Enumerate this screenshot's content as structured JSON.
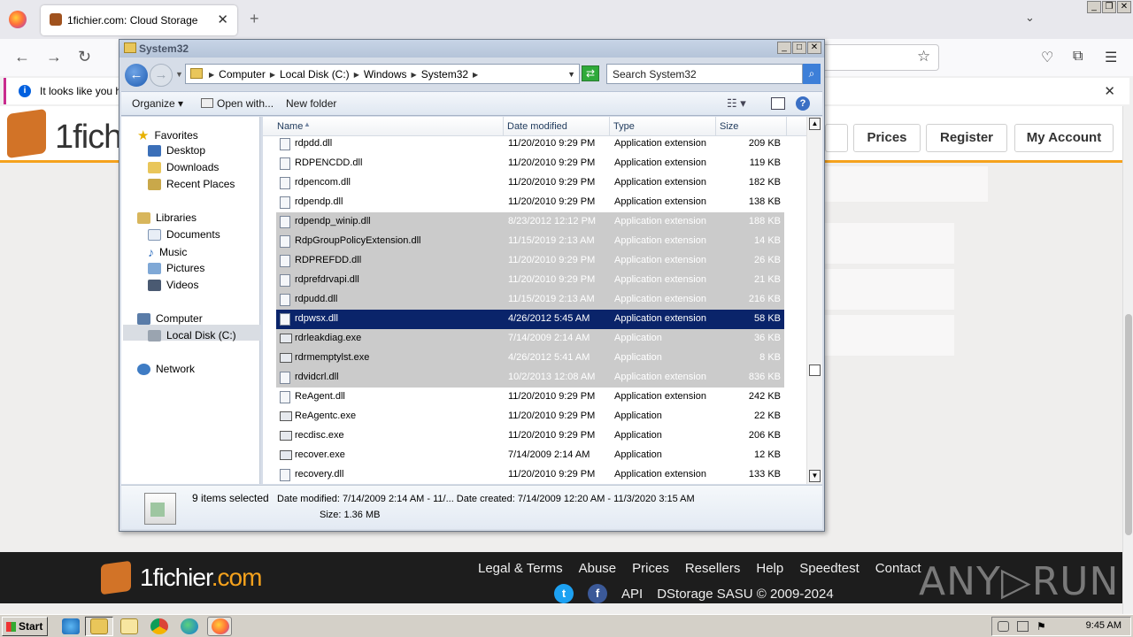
{
  "browser": {
    "tab_title": "1fichier.com: Cloud Storage",
    "tab_close": "✕",
    "new_tab": "+",
    "tab_list": "⌄",
    "back": "←",
    "forward": "→",
    "reload": "↻",
    "bookmark": "☆",
    "notification": "It looks like you ha",
    "notification_close": "✕",
    "window_controls": [
      "_",
      "❐",
      "✕"
    ]
  },
  "site": {
    "logo_text": "1fich",
    "nav": [
      "Prices",
      "Register",
      "My Account"
    ],
    "footer": {
      "logo_main": "1fichier",
      "logo_tld": ".com",
      "links": [
        "Legal & Terms",
        "Abuse",
        "Prices",
        "Resellers",
        "Help",
        "Speedtest",
        "Contact"
      ],
      "api": "API",
      "copyright": "DStorage SASU © 2009-2024"
    },
    "watermark": "ANY▷RUN"
  },
  "explorer": {
    "title": "System32",
    "window_controls": [
      "_",
      "□",
      "✕"
    ],
    "breadcrumb": [
      "Computer",
      "Local Disk (C:)",
      "Windows",
      "System32"
    ],
    "search_placeholder": "Search System32",
    "toolbar": {
      "organize": "Organize ▾",
      "open_with": "Open with...",
      "new_folder": "New folder",
      "help": "?"
    },
    "nav": {
      "favorites": "Favorites",
      "desktop": "Desktop",
      "downloads": "Downloads",
      "recent": "Recent Places",
      "libraries": "Libraries",
      "documents": "Documents",
      "music": "Music",
      "pictures": "Pictures",
      "videos": "Videos",
      "computer": "Computer",
      "local_disk": "Local Disk (C:)",
      "network": "Network"
    },
    "columns": [
      "Name",
      "Date modified",
      "Type",
      "Size"
    ],
    "files": [
      {
        "name": "rdpdd.dll",
        "date": "11/20/2010 9:29 PM",
        "type": "Application extension",
        "size": "209 KB",
        "state": "normal",
        "kind": "dll"
      },
      {
        "name": "RDPENCDD.dll",
        "date": "11/20/2010 9:29 PM",
        "type": "Application extension",
        "size": "119 KB",
        "state": "normal",
        "kind": "dll"
      },
      {
        "name": "rdpencom.dll",
        "date": "11/20/2010 9:29 PM",
        "type": "Application extension",
        "size": "182 KB",
        "state": "normal",
        "kind": "dll"
      },
      {
        "name": "rdpendp.dll",
        "date": "11/20/2010 9:29 PM",
        "type": "Application extension",
        "size": "138 KB",
        "state": "normal",
        "kind": "dll"
      },
      {
        "name": "rdpendp_winip.dll",
        "date": "8/23/2012 12:12 PM",
        "type": "Application extension",
        "size": "188 KB",
        "state": "selected",
        "kind": "dll"
      },
      {
        "name": "RdpGroupPolicyExtension.dll",
        "date": "11/15/2019 2:13 AM",
        "type": "Application extension",
        "size": "14 KB",
        "state": "selected",
        "kind": "dll"
      },
      {
        "name": "RDPREFDD.dll",
        "date": "11/20/2010 9:29 PM",
        "type": "Application extension",
        "size": "26 KB",
        "state": "selected",
        "kind": "dll"
      },
      {
        "name": "rdprefdrvapi.dll",
        "date": "11/20/2010 9:29 PM",
        "type": "Application extension",
        "size": "21 KB",
        "state": "selected",
        "kind": "dll"
      },
      {
        "name": "rdpudd.dll",
        "date": "11/15/2019 2:13 AM",
        "type": "Application extension",
        "size": "216 KB",
        "state": "selected",
        "kind": "dll"
      },
      {
        "name": "rdpwsx.dll",
        "date": "4/26/2012 5:45 AM",
        "type": "Application extension",
        "size": "58 KB",
        "state": "focused",
        "kind": "dll"
      },
      {
        "name": "rdrleakdiag.exe",
        "date": "7/14/2009 2:14 AM",
        "type": "Application",
        "size": "36 KB",
        "state": "selected",
        "kind": "exe"
      },
      {
        "name": "rdrmemptylst.exe",
        "date": "4/26/2012 5:41 AM",
        "type": "Application",
        "size": "8 KB",
        "state": "selected",
        "kind": "exe"
      },
      {
        "name": "rdvidcrl.dll",
        "date": "10/2/2013 12:08 AM",
        "type": "Application extension",
        "size": "836 KB",
        "state": "selected",
        "kind": "dll"
      },
      {
        "name": "ReAgent.dll",
        "date": "11/20/2010 9:29 PM",
        "type": "Application extension",
        "size": "242 KB",
        "state": "normal",
        "kind": "dll"
      },
      {
        "name": "ReAgentc.exe",
        "date": "11/20/2010 9:29 PM",
        "type": "Application",
        "size": "22 KB",
        "state": "normal",
        "kind": "exe"
      },
      {
        "name": "recdisc.exe",
        "date": "11/20/2010 9:29 PM",
        "type": "Application",
        "size": "206 KB",
        "state": "normal",
        "kind": "exe"
      },
      {
        "name": "recover.exe",
        "date": "7/14/2009 2:14 AM",
        "type": "Application",
        "size": "12 KB",
        "state": "normal",
        "kind": "exe"
      },
      {
        "name": "recovery.dll",
        "date": "11/20/2010 9:29 PM",
        "type": "Application extension",
        "size": "133 KB",
        "state": "normal",
        "kind": "dll"
      }
    ],
    "details": {
      "selected_count": "9 items selected",
      "line1": "Date modified: 7/14/2009 2:14 AM - 11/... Date created: 7/14/2009 12:20 AM - 11/3/2020 3:15 AM",
      "line2": "Size: 1.36 MB"
    }
  },
  "taskbar": {
    "start": "Start",
    "clock": "9:45 AM"
  }
}
